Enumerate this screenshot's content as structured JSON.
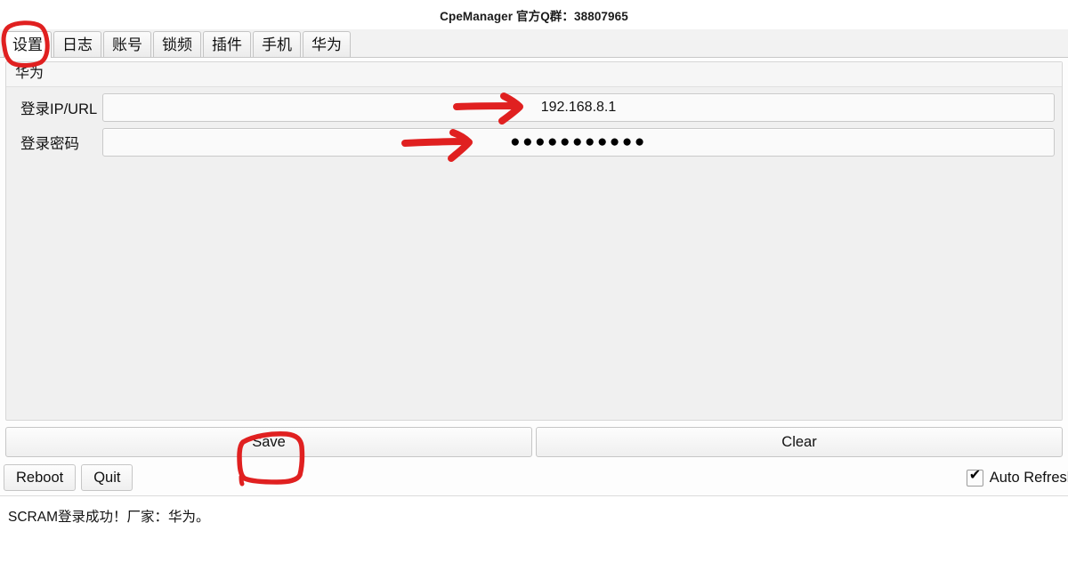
{
  "window": {
    "title": "CpeManager 官方Q群：38807965"
  },
  "tabs": [
    {
      "label": "设置",
      "active": true
    },
    {
      "label": "日志",
      "active": false
    },
    {
      "label": "账号",
      "active": false
    },
    {
      "label": "锁频",
      "active": false
    },
    {
      "label": "插件",
      "active": false
    },
    {
      "label": "手机",
      "active": false
    },
    {
      "label": "华为",
      "active": false
    }
  ],
  "panel": {
    "group_title": "华为",
    "fields": [
      {
        "label": "登录IP/URL",
        "value": "192.168.8.1"
      },
      {
        "label": "登录密码",
        "value": "●●●●●●●●●●●"
      }
    ]
  },
  "actions": {
    "save_label": "Save",
    "clear_label": "Clear"
  },
  "bottom": {
    "reboot_label": "Reboot",
    "quit_label": "Quit",
    "auto_refresh_label": "Auto Refresh",
    "auto_refresh_checked": "✔"
  },
  "status": {
    "message": "SCRAM登录成功！厂家：华为。"
  },
  "annotations": {
    "color": "#e02020",
    "items": [
      {
        "name": "settings-tab-circle",
        "target": "设置"
      },
      {
        "name": "ip-field-arrow",
        "target": "192.168.8.1"
      },
      {
        "name": "password-field-arrow",
        "target": "登录密码"
      },
      {
        "name": "save-button-box",
        "target": "Save"
      }
    ]
  }
}
